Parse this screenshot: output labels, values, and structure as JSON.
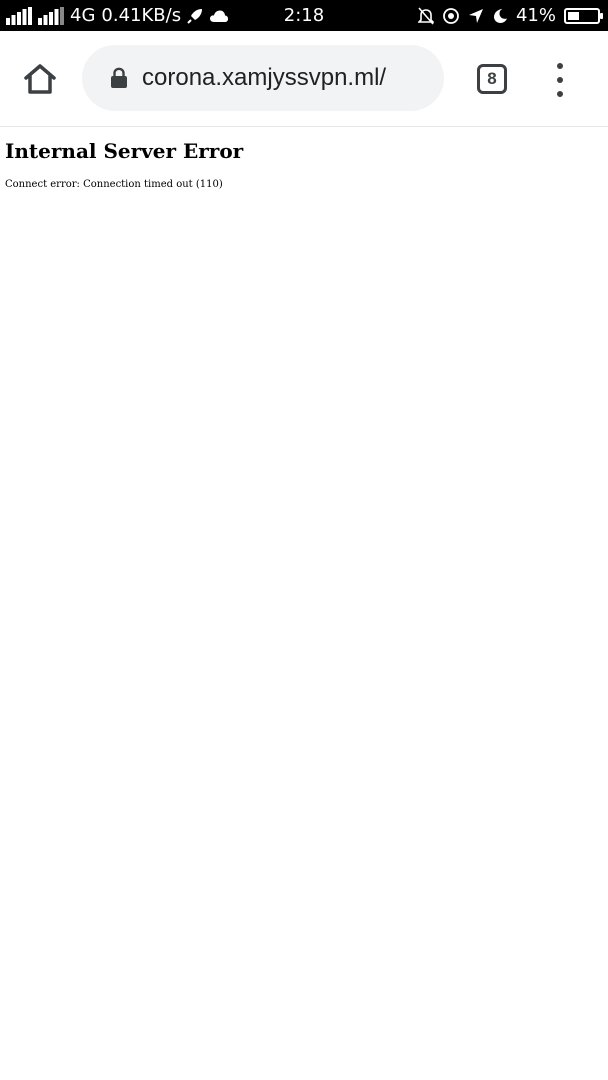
{
  "status_bar": {
    "network": "4G",
    "speed": "0.41KB/s",
    "time": "2:18",
    "battery_percent": "41%",
    "battery_level": 0.41
  },
  "toolbar": {
    "url": "corona.xamjyssvpn.ml/",
    "tab_count": "8"
  },
  "page": {
    "title": "Internal Server Error",
    "message": "Connect error: Connection timed out (110)"
  }
}
